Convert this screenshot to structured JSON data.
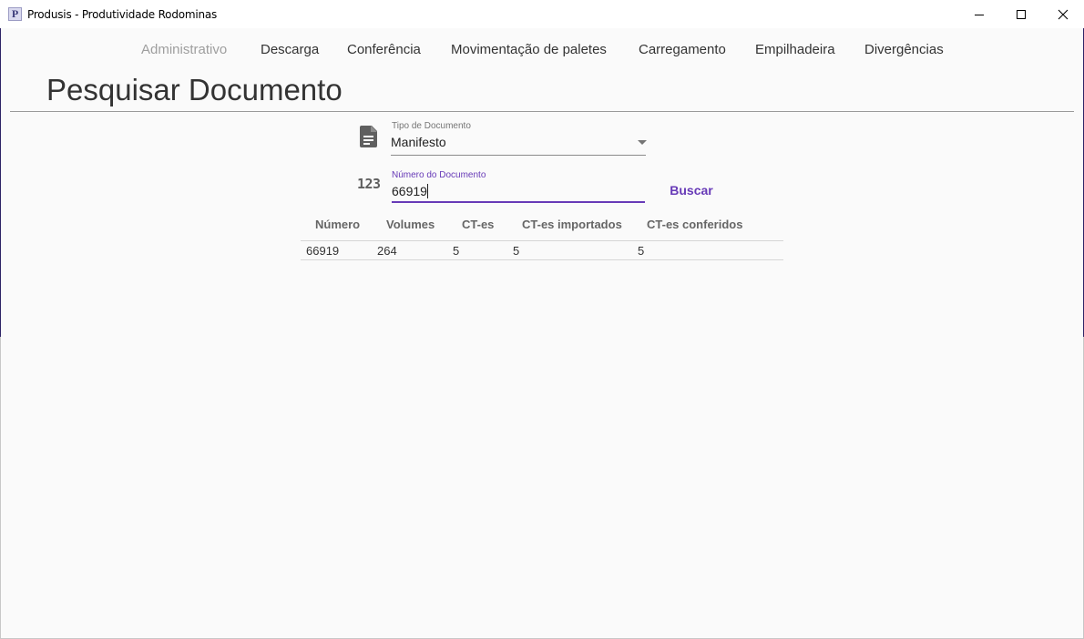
{
  "window": {
    "icon_letter": "P",
    "title": "Produsis - Produtividade Rodominas"
  },
  "nav": {
    "items": [
      {
        "label": "Administrativo",
        "disabled": true
      },
      {
        "label": "Descarga"
      },
      {
        "label": "Conferência"
      },
      {
        "label": "Movimentação de paletes"
      },
      {
        "label": "Carregamento"
      },
      {
        "label": "Empilhadeira"
      },
      {
        "label": "Divergências"
      }
    ]
  },
  "page": {
    "title": "Pesquisar Documento"
  },
  "form": {
    "doc_type": {
      "label": "Tipo de Documento",
      "value": "Manifesto",
      "icon": "document-icon"
    },
    "doc_number": {
      "label": "Número do Documento",
      "value": "66919",
      "icon_text": "123"
    },
    "search_button": "Buscar"
  },
  "table": {
    "headers": [
      "Número",
      "Volumes",
      "CT-es",
      "CT-es importados",
      "CT-es conferidos"
    ],
    "rows": [
      [
        "66919",
        "264",
        "5",
        "5",
        "5"
      ]
    ]
  },
  "colors": {
    "accent": "#673ab7",
    "frame": "#2d2466",
    "background": "#fafafa"
  }
}
